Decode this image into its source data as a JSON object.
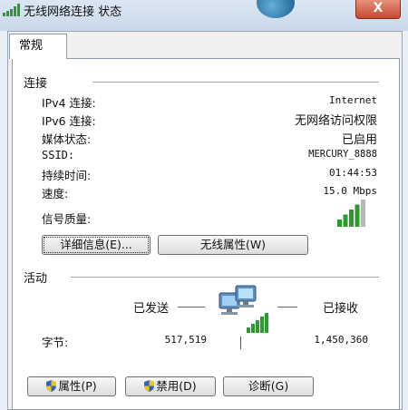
{
  "window": {
    "title": "无线网络连接 状态",
    "close_label": "X"
  },
  "tabs": [
    {
      "label": "常规"
    }
  ],
  "connection": {
    "section_title": "连接",
    "rows": [
      {
        "label": "IPv4 连接:",
        "value": "Internet"
      },
      {
        "label": "IPv6 连接:",
        "value": "无网络访问权限"
      },
      {
        "label": "媒体状态:",
        "value": "已启用"
      },
      {
        "label": "SSID:",
        "value": "MERCURY_8888"
      },
      {
        "label": "持续时间:",
        "value": "01:44:53"
      },
      {
        "label": "速度:",
        "value": "15.0 Mbps"
      }
    ],
    "signal_label": "信号质量:",
    "signal_bars": 4,
    "signal_max": 5,
    "details_button": "详细信息(E)...",
    "wireless_props_button": "无线属性(W)"
  },
  "activity": {
    "section_title": "活动",
    "sent_label": "已发送",
    "received_label": "已接收",
    "bytes_label": "字节:",
    "sent_bytes": "517,519",
    "received_bytes": "1,450,360"
  },
  "buttons": {
    "properties": "属性(P)",
    "disable": "禁用(D)",
    "diagnose": "诊断(G)"
  },
  "colors": {
    "signal_active": "#2e9a2e",
    "signal_inactive": "#b8b8b8",
    "shield_blue": "#2f63c4",
    "shield_yellow": "#f0c419"
  }
}
